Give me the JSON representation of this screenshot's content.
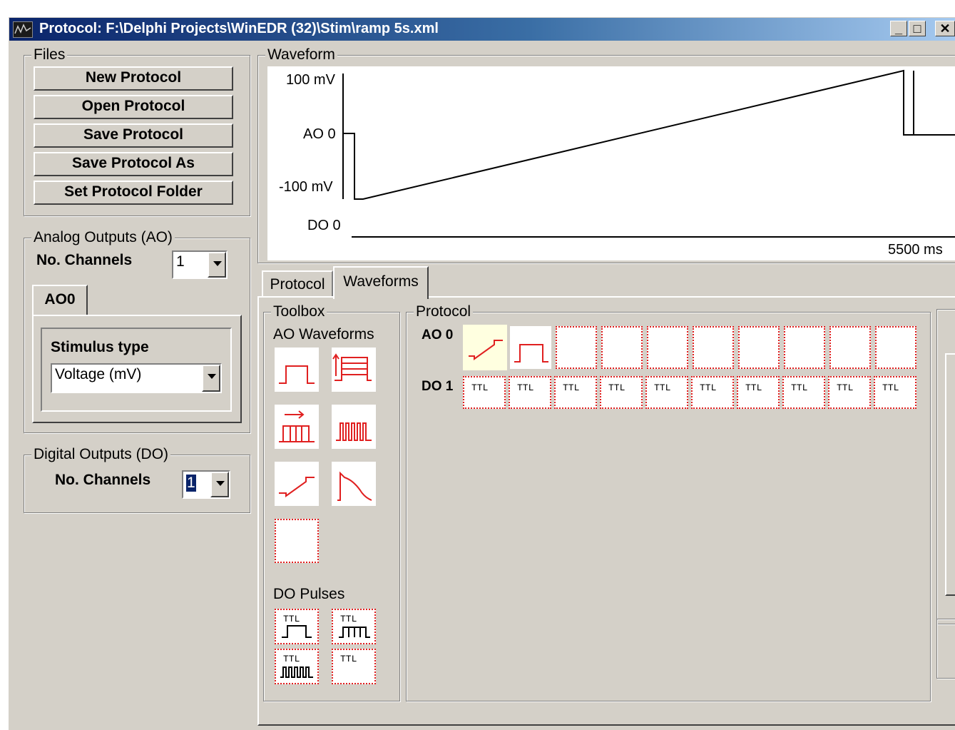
{
  "window": {
    "title": "Protocol: F:\\Delphi Projects\\WinEDR (32)\\Stim\\ramp 5s.xml",
    "min_label": "_",
    "max_label": "□",
    "close_label": "✕"
  },
  "files": {
    "group_label": "Files",
    "buttons": [
      "New Protocol",
      "Open Protocol",
      "Save Protocol",
      "Save Protocol As",
      "Set Protocol Folder"
    ]
  },
  "analog": {
    "group_label": "Analog Outputs (AO)",
    "channels_label": "No. Channels",
    "channels_value": "1",
    "tab_label": "AO0",
    "stimulus_label": "Stimulus type",
    "stimulus_value": "Voltage (mV)"
  },
  "digital": {
    "group_label": "Digital Outputs (DO)",
    "channels_label": "No. Channels",
    "channels_value": "1"
  },
  "waveform": {
    "group_label": "Waveform",
    "y_top_label": "100 mV",
    "ao_label": "AO 0",
    "y_bottom_label": "-100 mV",
    "do_label": "DO 0",
    "x_end_label": "5500 ms"
  },
  "tabs": {
    "protocol": "Protocol",
    "waveforms": "Waveforms"
  },
  "toolbox": {
    "group_label": "Toolbox",
    "ao_section": "AO Waveforms",
    "ao_icons": [
      "step-pulse-icon",
      "family-of-steps-icon",
      "pulse-train-family-icon",
      "pulse-train-icon",
      "ramp-icon",
      "action-potential-waveform-icon",
      "empty-waveform-icon"
    ],
    "do_section": "DO Pulses",
    "do_icons": [
      "ttl-single-pulse-icon",
      "ttl-pulse-train-family-icon",
      "ttl-pulse-train-icon",
      "ttl-none-icon"
    ],
    "ttl_text": "TTL"
  },
  "protocol_area": {
    "group_label": "Protocol",
    "ao_row_label": "AO 0",
    "do_row_label": "DO 1",
    "ttl_text": "TTL"
  },
  "colors": {
    "waveform_icon": "#e02020",
    "title_start": "#0a246a",
    "title_end": "#a6caf0",
    "window_bg": "#d4d0c8",
    "selected_slot": "#ffffe0"
  }
}
